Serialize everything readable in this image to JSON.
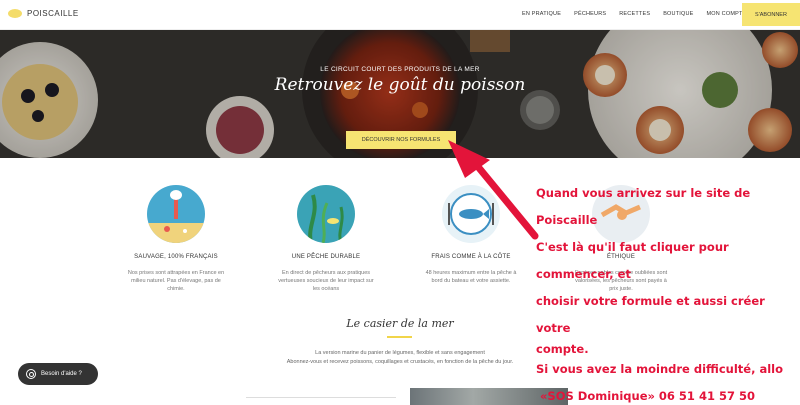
{
  "nav": {
    "logo_text": "POISCAILLE",
    "links": [
      "EN PRATIQUE",
      "PÊCHEURS",
      "RECETTES",
      "BOUTIQUE",
      "MON COMPTE"
    ],
    "subscribe_label": "S'ABONNER"
  },
  "hero": {
    "kicker": "LE CIRCUIT COURT DES PRODUITS DE LA MER",
    "title": "Retrouvez le goût du poisson",
    "cta_label": "DÉCOUVRIR NOS FORMULES"
  },
  "features": [
    {
      "title": "SAUVAGE, 100% FRANÇAIS",
      "desc": "Nos prises sont attrapées en France en milieu naturel. Pas d'élevage, pas de chimie.",
      "icon": "bird-beach-icon",
      "color": "#47a9cf"
    },
    {
      "title": "UNE PÊCHE DURABLE",
      "desc": "En direct de pêcheurs aux pratiques vertueuses soucieux de leur impact sur les océans",
      "icon": "seaweed-fish-icon",
      "color": "#3aa3b6"
    },
    {
      "title": "FRAIS COMME À LA CÔTE",
      "desc": "48 heures maximum entre la pêche à bord du bateau et votre assiette.",
      "icon": "fish-plate-icon",
      "color": "#e7f2f7"
    },
    {
      "title": "ÉTHIQUE",
      "desc": "Espèces nobles comme oubliées sont valorisées, les pêcheurs sont payés à prix juste.",
      "icon": "handshake-icon",
      "color": "#e9eef2"
    }
  ],
  "section": {
    "title": "Le casier de la mer",
    "desc_line1": "La version marine du panier de légumes, flexible et sans engagement",
    "desc_line2": "Abonnez-vous et recevez poissons, coquillages et crustacés, en fonction de la pêche du jour."
  },
  "help_label": "Besoin d'aide ?",
  "annotation": {
    "line1": "Quand vous arrivez sur le site de  Poiscaille",
    "line2": "C'est là qu'il faut cliquer pour commencer, et",
    "line3": "choisir votre formule et aussi créer votre",
    "line4": "compte.",
    "line5": "Si vous avez la moindre difficulté, allo",
    "line6": "«SOS Dominique»  06 51 41 57 50",
    "color": "#e3143a"
  }
}
